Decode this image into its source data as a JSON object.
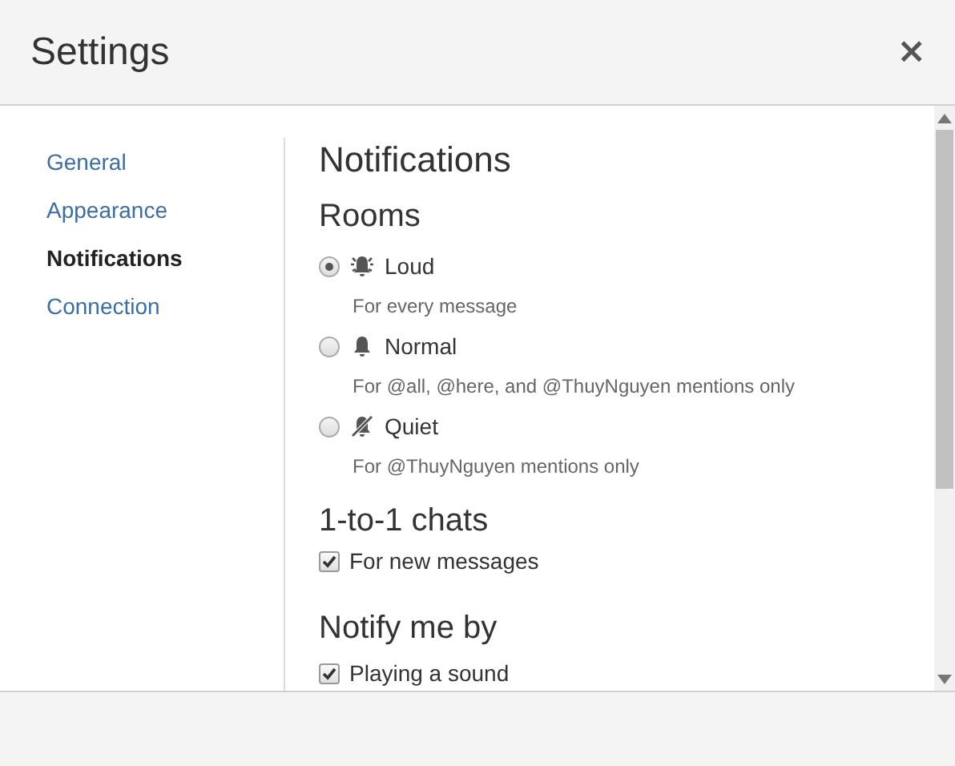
{
  "window": {
    "title": "Settings",
    "close": "×"
  },
  "sidebar": {
    "items": [
      {
        "label": "General",
        "selected": false
      },
      {
        "label": "Appearance",
        "selected": false
      },
      {
        "label": "Notifications",
        "selected": true
      },
      {
        "label": "Connection",
        "selected": false
      }
    ]
  },
  "content": {
    "title": "Notifications",
    "sections": [
      {
        "heading": "Rooms",
        "options": [
          {
            "kind": "radio",
            "label": "Loud",
            "description": "For every message",
            "selected": true
          },
          {
            "kind": "radio",
            "label": "Normal",
            "description": "For @all, @here, and @ThuyNguyen mentions only",
            "selected": false
          },
          {
            "kind": "radio",
            "label": "Quiet",
            "description": "For @ThuyNguyen mentions only",
            "selected": false
          }
        ]
      },
      {
        "heading": "1-to-1 chats",
        "options": [
          {
            "kind": "checkbox",
            "label": "For new messages",
            "checked": true
          }
        ]
      },
      {
        "heading": "Notify me by",
        "options": [
          {
            "kind": "checkbox",
            "label": "Playing a sound",
            "checked": true
          }
        ]
      }
    ]
  }
}
